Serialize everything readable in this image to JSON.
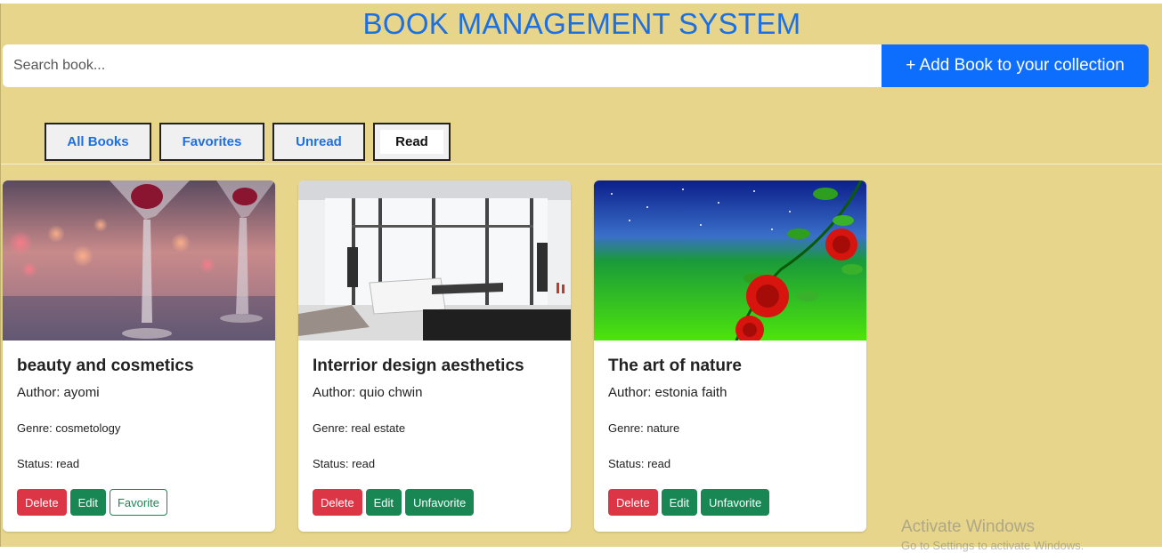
{
  "header": {
    "title": "BOOK MANAGEMENT SYSTEM"
  },
  "search": {
    "placeholder": "Search book...",
    "value": ""
  },
  "add_button": {
    "label": "+ Add Book to your collection"
  },
  "tabs": [
    {
      "label": "All Books",
      "active": false
    },
    {
      "label": "Favorites",
      "active": false
    },
    {
      "label": "Unread",
      "active": false
    },
    {
      "label": "Read",
      "active": true
    }
  ],
  "books": [
    {
      "title": "beauty and cosmetics",
      "author": "Author: ayomi",
      "genre": "Genre: cosmetology",
      "status": "Status: read",
      "image": "cocktail-glasses-bokeh",
      "delete_label": "Delete",
      "edit_label": "Edit",
      "favorite_label": "Favorite"
    },
    {
      "title": "Interrior design aesthetics",
      "author": "Author: quio chwin",
      "genre": "Genre: real estate",
      "status": "Status: read",
      "image": "modern-living-room",
      "delete_label": "Delete",
      "edit_label": "Edit",
      "favorite_label": "Unfavorite"
    },
    {
      "title": "The art of nature",
      "author": "Author: estonia faith",
      "genre": "Genre: nature",
      "status": "Status: read",
      "image": "roses-green-starry-sky",
      "delete_label": "Delete",
      "edit_label": "Edit",
      "favorite_label": "Unfavorite"
    }
  ],
  "watermark": {
    "title": "Activate Windows",
    "subtitle": "Go to Settings to activate Windows."
  },
  "colors": {
    "background": "#e6d58a",
    "accent": "#0d6efd",
    "title": "#1e6fe0",
    "danger": "#dc3545",
    "success": "#198754"
  }
}
